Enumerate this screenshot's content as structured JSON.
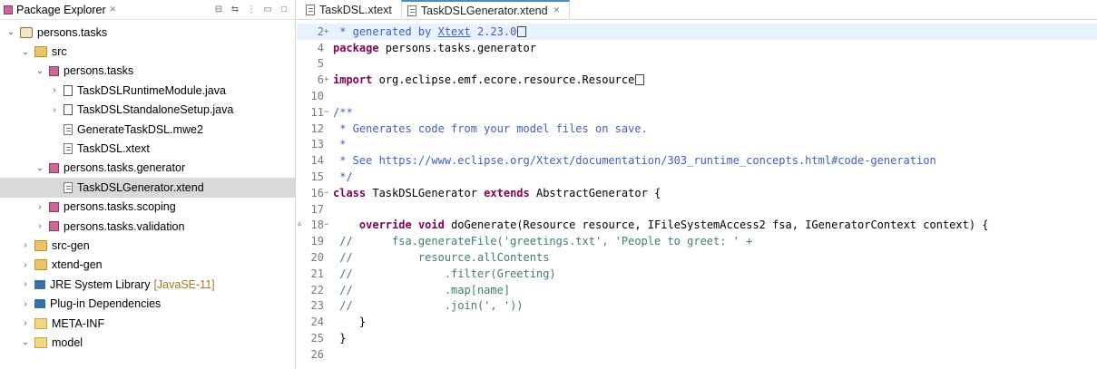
{
  "explorer": {
    "title": "Package Explorer",
    "close_glyph": "✕",
    "tree": [
      {
        "label": "persons.tasks",
        "depth": 0,
        "chevron": "open",
        "icon": "project-icon",
        "selected": false
      },
      {
        "label": "src",
        "depth": 1,
        "chevron": "open",
        "icon": "source-folder-icon",
        "selected": false
      },
      {
        "label": "persons.tasks",
        "depth": 2,
        "chevron": "open",
        "icon": "package-icon",
        "selected": false
      },
      {
        "label": "TaskDSLRuntimeModule.java",
        "depth": 3,
        "chevron": "closed",
        "icon": "java-file-icon",
        "selected": false
      },
      {
        "label": "TaskDSLStandaloneSetup.java",
        "depth": 3,
        "chevron": "closed",
        "icon": "java-file-icon",
        "selected": false
      },
      {
        "label": "GenerateTaskDSL.mwe2",
        "depth": 3,
        "chevron": "none",
        "icon": "file-icon",
        "selected": false
      },
      {
        "label": "TaskDSL.xtext",
        "depth": 3,
        "chevron": "none",
        "icon": "file-icon",
        "selected": false
      },
      {
        "label": "persons.tasks.generator",
        "depth": 2,
        "chevron": "open",
        "icon": "package-icon",
        "selected": false
      },
      {
        "label": "TaskDSLGenerator.xtend",
        "depth": 3,
        "chevron": "none",
        "icon": "file-icon",
        "selected": true
      },
      {
        "label": "persons.tasks.scoping",
        "depth": 2,
        "chevron": "closed",
        "icon": "package-icon",
        "selected": false
      },
      {
        "label": "persons.tasks.validation",
        "depth": 2,
        "chevron": "closed",
        "icon": "package-icon",
        "selected": false
      },
      {
        "label": "src-gen",
        "depth": 1,
        "chevron": "closed",
        "icon": "source-folder-icon",
        "selected": false
      },
      {
        "label": "xtend-gen",
        "depth": 1,
        "chevron": "closed",
        "icon": "source-folder-icon",
        "selected": false
      },
      {
        "label": "JRE System Library",
        "extra": "[JavaSE-11]",
        "depth": 1,
        "chevron": "closed",
        "icon": "library-icon",
        "selected": false
      },
      {
        "label": "Plug-in Dependencies",
        "depth": 1,
        "chevron": "closed",
        "icon": "library-icon",
        "selected": false
      },
      {
        "label": "META-INF",
        "depth": 1,
        "chevron": "closed",
        "icon": "folder-icon",
        "selected": false
      },
      {
        "label": "model",
        "depth": 1,
        "chevron": "open",
        "icon": "folder-icon",
        "selected": false
      }
    ]
  },
  "editor": {
    "tabs": [
      {
        "label": "TaskDSL.xtext",
        "active": false
      },
      {
        "label": "TaskDSLGenerator.xtend",
        "active": true,
        "close_glyph": "✕"
      }
    ],
    "lines": [
      {
        "n": "2",
        "fold": "+",
        "current": true,
        "tokens": [
          [
            "cmt-doc",
            " * generated by "
          ],
          [
            "cmt-doc ul",
            "Xtext"
          ],
          [
            "cmt-doc",
            " 2.23.0"
          ],
          [
            "box",
            ""
          ]
        ]
      },
      {
        "n": "4",
        "fold": "",
        "tokens": [
          [
            "kw",
            "package"
          ],
          [
            "src",
            " persons.tasks.generator"
          ]
        ]
      },
      {
        "n": "5",
        "fold": "",
        "tokens": []
      },
      {
        "n": "6",
        "fold": "+",
        "tokens": [
          [
            "kw",
            "import"
          ],
          [
            "src",
            " org.eclipse.emf.ecore.resource.Resource"
          ],
          [
            "box",
            ""
          ]
        ]
      },
      {
        "n": "10",
        "fold": "",
        "tokens": []
      },
      {
        "n": "11",
        "fold": "−",
        "tokens": [
          [
            "cmt-doc",
            "/**"
          ]
        ]
      },
      {
        "n": "12",
        "fold": "",
        "tokens": [
          [
            "cmt-doc",
            " * Generates code from your model files on save."
          ]
        ]
      },
      {
        "n": "13",
        "fold": "",
        "tokens": [
          [
            "cmt-doc",
            " *"
          ]
        ]
      },
      {
        "n": "14",
        "fold": "",
        "tokens": [
          [
            "cmt-doc",
            " * See https://www.eclipse.org/Xtext/documentation/303_runtime_concepts.html#code-generation"
          ]
        ]
      },
      {
        "n": "15",
        "fold": "",
        "tokens": [
          [
            "cmt-doc",
            " */"
          ]
        ]
      },
      {
        "n": "16",
        "fold": "−",
        "tokens": [
          [
            "kw",
            "class"
          ],
          [
            "src",
            " TaskDSLGenerator "
          ],
          [
            "kw",
            "extends"
          ],
          [
            "src",
            " AbstractGenerator {"
          ]
        ]
      },
      {
        "n": "17",
        "fold": "",
        "tokens": []
      },
      {
        "n": "18",
        "fold": "−",
        "override": true,
        "tokens": [
          [
            "src",
            "    "
          ],
          [
            "kw",
            "override"
          ],
          [
            "src",
            " "
          ],
          [
            "kw",
            "void"
          ],
          [
            "src",
            " doGenerate(Resource resource, IFileSystemAccess2 fsa, IGeneratorContext context) {"
          ]
        ]
      },
      {
        "n": "19",
        "fold": "",
        "tokens": [
          [
            "cm",
            " //      fsa.generateFile('greetings.txt', 'People to greet: ' +"
          ]
        ]
      },
      {
        "n": "20",
        "fold": "",
        "tokens": [
          [
            "cm",
            " //          resource.allContents"
          ]
        ]
      },
      {
        "n": "21",
        "fold": "",
        "tokens": [
          [
            "cm",
            " //              .filter(Greeting)"
          ]
        ]
      },
      {
        "n": "22",
        "fold": "",
        "tokens": [
          [
            "cm",
            " //              .map[name]"
          ]
        ]
      },
      {
        "n": "23",
        "fold": "",
        "tokens": [
          [
            "cm",
            " //              .join(', '))"
          ]
        ]
      },
      {
        "n": "24",
        "fold": "",
        "tokens": [
          [
            "src",
            "    }"
          ]
        ]
      },
      {
        "n": "25",
        "fold": "",
        "tokens": [
          [
            "src",
            " }"
          ]
        ]
      },
      {
        "n": "26",
        "fold": "",
        "tokens": []
      }
    ]
  }
}
